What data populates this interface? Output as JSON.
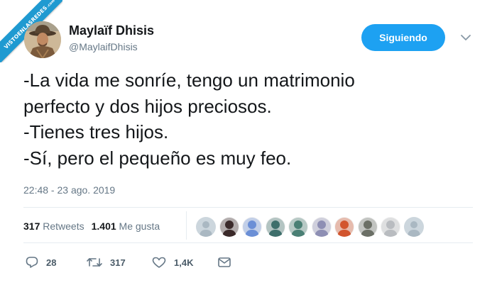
{
  "watermark": {
    "text": "VISTOENLASREDES",
    "suffix": ".com"
  },
  "user": {
    "display_name": "Maylaïf Dhisis",
    "handle": "@MaylaifDhisis",
    "avatar_icon": "avatar-photo"
  },
  "follow_button": {
    "label": "Siguiendo",
    "color": "#1da1f2"
  },
  "menu_icon": "chevron-down-icon",
  "tweet": {
    "lines": [
      "-La vida me sonríe, tengo un matrimonio",
      "perfecto y dos hijos preciosos.",
      "-Tienes tres hijos.",
      "-Sí, pero el pequeño es muy feo."
    ],
    "timestamp": "22:48 - 23 ago. 2019"
  },
  "stats": {
    "retweets_count": "317",
    "retweets_label": "Retweets",
    "likes_count": "1.401",
    "likes_label": "Me gusta"
  },
  "likers": [
    {
      "kind": "default",
      "color": "#aab8c2"
    },
    {
      "kind": "photo",
      "color": "#3b2a2a"
    },
    {
      "kind": "photo",
      "color": "#6b8fd6"
    },
    {
      "kind": "photo",
      "color": "#3e6f6b"
    },
    {
      "kind": "photo",
      "color": "#4a7f74"
    },
    {
      "kind": "photo",
      "color": "#8e8fb4"
    },
    {
      "kind": "photo",
      "color": "#d2552e"
    },
    {
      "kind": "photo",
      "color": "#6b6f66"
    },
    {
      "kind": "photo",
      "color": "#b9bcc0"
    },
    {
      "kind": "default",
      "color": "#aab8c2"
    }
  ],
  "actions": {
    "reply_count": "28",
    "retweet_count": "317",
    "like_count": "1,4K"
  },
  "colors": {
    "text_primary": "#14171a",
    "text_secondary": "#657786",
    "divider": "#e6ecf0"
  }
}
